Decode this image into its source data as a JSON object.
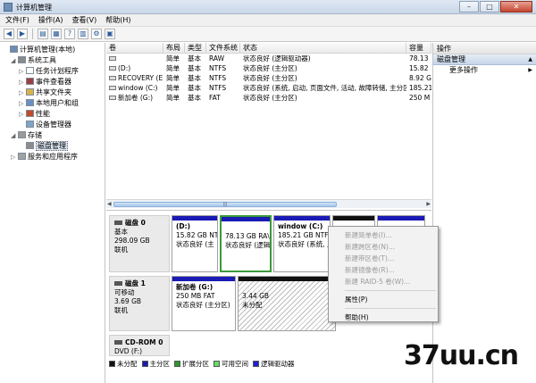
{
  "window": {
    "title": "计算机管理",
    "min": "–",
    "max": "□",
    "close": "✕"
  },
  "menu": [
    "文件(F)",
    "操作(A)",
    "查看(V)",
    "帮助(H)"
  ],
  "toolbar": [
    "◀",
    "▶",
    "▤",
    "▦",
    "?",
    "▥",
    "⚙",
    "▣"
  ],
  "tree": [
    {
      "label": "计算机管理(本地)",
      "exp": "",
      "indent": 0,
      "color": "#6d8cb3"
    },
    {
      "label": "系统工具",
      "exp": "◢",
      "indent": 1,
      "color": "#8a8a8a"
    },
    {
      "label": "任务计划程序",
      "exp": "▷",
      "indent": 2,
      "color": "#ffffff"
    },
    {
      "label": "事件查看器",
      "exp": "▷",
      "indent": 2,
      "color": "#9d3f3f"
    },
    {
      "label": "共享文件夹",
      "exp": "▷",
      "indent": 2,
      "color": "#d8b34a"
    },
    {
      "label": "本地用户和组",
      "exp": "▷",
      "indent": 2,
      "color": "#6a8fc2"
    },
    {
      "label": "性能",
      "exp": "▷",
      "indent": 2,
      "color": "#c44a2a"
    },
    {
      "label": "设备管理器",
      "exp": "",
      "indent": 2,
      "color": "#7ea3c8"
    },
    {
      "label": "存储",
      "exp": "◢",
      "indent": 1,
      "color": "#9a9a9a"
    },
    {
      "label": "磁盘管理",
      "exp": "",
      "indent": 2,
      "color": "#8d8d8d",
      "selected": true
    },
    {
      "label": "服务和应用程序",
      "exp": "▷",
      "indent": 1,
      "color": "#a2a2a2"
    }
  ],
  "volumes": {
    "headers": [
      "卷",
      "布局",
      "类型",
      "文件系统",
      "状态",
      "容量"
    ],
    "rows": [
      [
        "",
        "简单",
        "基本",
        "RAW",
        "状态良好 (逻辑驱动器)",
        "78.13"
      ],
      [
        "(D:)",
        "简单",
        "基本",
        "NTFS",
        "状态良好 (主分区)",
        "15.82"
      ],
      [
        "RECOVERY (E:)",
        "简单",
        "基本",
        "NTFS",
        "状态良好 (主分区)",
        "8.92 G"
      ],
      [
        "window (C:)",
        "简单",
        "基本",
        "NTFS",
        "状态良好 (系统, 启动, 页面文件, 活动, 故障转储, 主分区)",
        "185.21"
      ],
      [
        "新加卷 (G:)",
        "简单",
        "基本",
        "FAT",
        "状态良好 (主分区)",
        "250 M"
      ]
    ],
    "scroll_grip": "|||"
  },
  "disks": [
    {
      "name": "磁盘 0",
      "type": "基本",
      "size": "298.09 GB",
      "status": "联机",
      "parts": [
        {
          "name": "(D:)",
          "size": "15.82 GB NT",
          "status": "状态良好 (主",
          "bar": "blue"
        },
        {
          "name": "",
          "size": "78.13 GB RA\\",
          "status": "状态良好 (逻辑",
          "bar": "blue",
          "selected": true
        },
        {
          "name": "window  (C:)",
          "size": "185.21 GB NTFS",
          "status": "状态良好 (系统, 启",
          "bar": "blue"
        },
        {
          "name": "",
          "size": "",
          "status": "",
          "bar": "black"
        },
        {
          "name": "",
          "size": "",
          "status": "",
          "bar": "blue"
        }
      ]
    },
    {
      "name": "磁盘 1",
      "type": "可移动",
      "size": "3.69 GB",
      "status": "联机",
      "parts": [
        {
          "name": "新加卷  (G:)",
          "size": "250 MB FAT",
          "status": "状态良好 (主分区)",
          "bar": "blue"
        },
        {
          "name": "",
          "size": "3.44 GB",
          "status": "未分配",
          "bar": "black",
          "hatch": true
        }
      ]
    },
    {
      "name": "CD-ROM 0",
      "type": "DVD (F:)",
      "size": "",
      "status": "",
      "parts": []
    }
  ],
  "legend": [
    {
      "label": "未分配",
      "color": "#111111"
    },
    {
      "label": "主分区",
      "color": "#1a1ab5"
    },
    {
      "label": "扩展分区",
      "color": "#2a9a2a"
    },
    {
      "label": "可用空间",
      "color": "#66dd66"
    },
    {
      "label": "逻辑驱动器",
      "color": "#2020d0"
    }
  ],
  "actions": {
    "header": "操作",
    "section": "磁盘管理",
    "more": "更多操作",
    "caret_up": "▲",
    "caret_right": "▶"
  },
  "context_menu": {
    "items": [
      {
        "label": "新建简单卷(I)...",
        "disabled": true
      },
      {
        "label": "新建跨区卷(N)...",
        "disabled": true
      },
      {
        "label": "新建带区卷(T)...",
        "disabled": true
      },
      {
        "label": "新建镜像卷(R)...",
        "disabled": true
      },
      {
        "label": "新建 RAID-5 卷(W)...",
        "disabled": true
      },
      {
        "sep": true
      },
      {
        "label": "属性(P)",
        "disabled": false
      },
      {
        "sep": true
      },
      {
        "label": "帮助(H)",
        "disabled": false
      }
    ]
  },
  "watermark": "37uu.cn"
}
